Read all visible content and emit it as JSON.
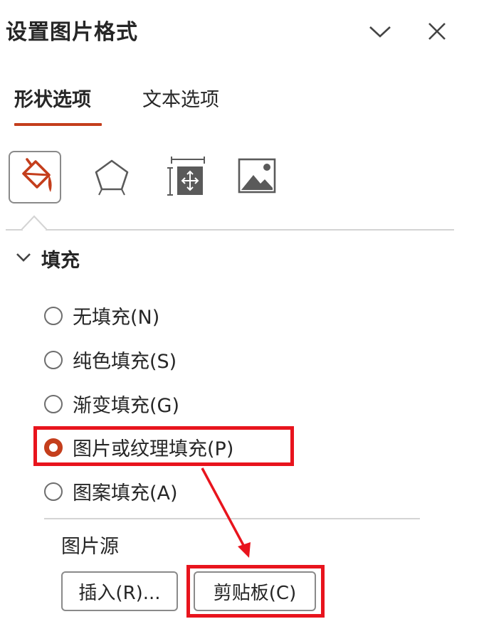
{
  "panel": {
    "title": "设置图片格式",
    "collapse_icon": "chevron-down-icon",
    "close_icon": "close-icon"
  },
  "tabs": [
    {
      "label": "形状选项",
      "active": true
    },
    {
      "label": "文本选项",
      "active": false
    }
  ],
  "categories": [
    {
      "icon": "fill-line-icon",
      "selected": true
    },
    {
      "icon": "effects-pentagon-icon",
      "selected": false
    },
    {
      "icon": "size-properties-icon",
      "selected": false
    },
    {
      "icon": "picture-icon",
      "selected": false
    }
  ],
  "fill_section": {
    "title": "填充",
    "expanded": true,
    "options": [
      {
        "label": "无填充(N)",
        "checked": false
      },
      {
        "label": "纯色填充(S)",
        "checked": false
      },
      {
        "label": "渐变填充(G)",
        "checked": false
      },
      {
        "label": "图片或纹理填充(P)",
        "checked": true
      },
      {
        "label": "图案填充(A)",
        "checked": false
      }
    ],
    "picture_source_label": "图片源",
    "insert_button": "插入(R)...",
    "clipboard_button": "剪贴板(C)"
  },
  "colors": {
    "accent": "#c43e1c",
    "annotation": "#e8141d"
  }
}
